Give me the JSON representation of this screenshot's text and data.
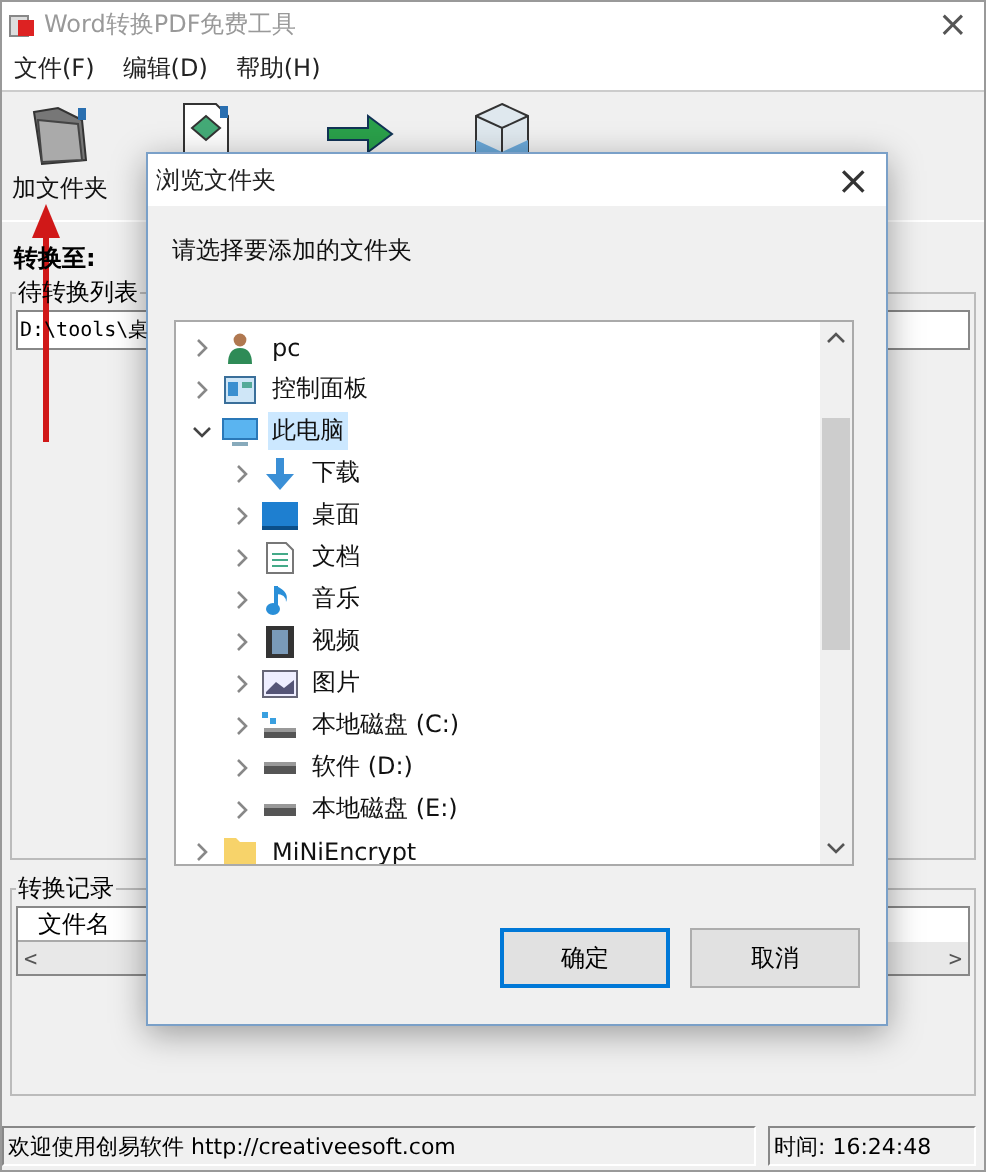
{
  "window": {
    "title": "Word转换PDF免费工具",
    "close": "×"
  },
  "menu": [
    {
      "label": "文件(F)"
    },
    {
      "label": "编辑(D)"
    },
    {
      "label": "帮助(H)"
    }
  ],
  "toolbar": {
    "label": "加文件夹"
  },
  "convert_to": {
    "label": "转换至:"
  },
  "pending_list": {
    "title": "待转换列表",
    "rows": [
      "D:\\tools\\桌"
    ]
  },
  "log": {
    "title": "转换记录",
    "columns": [
      "文件名"
    ],
    "scroll_left": "<",
    "scroll_right": ">"
  },
  "status_bar": {
    "message": "欢迎使用创易软件 http://creativeesoft.com",
    "time": "时间: 16:24:48"
  },
  "dialog": {
    "title": "浏览文件夹",
    "close": "×",
    "prompt": "请选择要添加的文件夹",
    "tree": [
      {
        "label": "pc",
        "expanded": false,
        "selected": false
      },
      {
        "label": "控制面板",
        "expanded": false,
        "selected": false
      },
      {
        "label": "此电脑",
        "expanded": true,
        "selected": true,
        "children": [
          {
            "label": "下载",
            "expanded": false,
            "selected": false
          },
          {
            "label": "桌面",
            "expanded": false,
            "selected": false
          },
          {
            "label": "文档",
            "expanded": false,
            "selected": false
          },
          {
            "label": "音乐",
            "expanded": false,
            "selected": false
          },
          {
            "label": "视频",
            "expanded": false,
            "selected": false
          },
          {
            "label": "图片",
            "expanded": false,
            "selected": false
          },
          {
            "label": "本地磁盘 (C:)",
            "expanded": false,
            "selected": false
          },
          {
            "label": "软件 (D:)",
            "expanded": false,
            "selected": false
          },
          {
            "label": "本地磁盘 (E:)",
            "expanded": false,
            "selected": false
          }
        ]
      },
      {
        "label": "MiNiEncrypt",
        "expanded": false,
        "selected": false
      }
    ],
    "buttons": [
      {
        "label": "确定",
        "default": true
      },
      {
        "label": "取消",
        "default": false
      }
    ]
  }
}
